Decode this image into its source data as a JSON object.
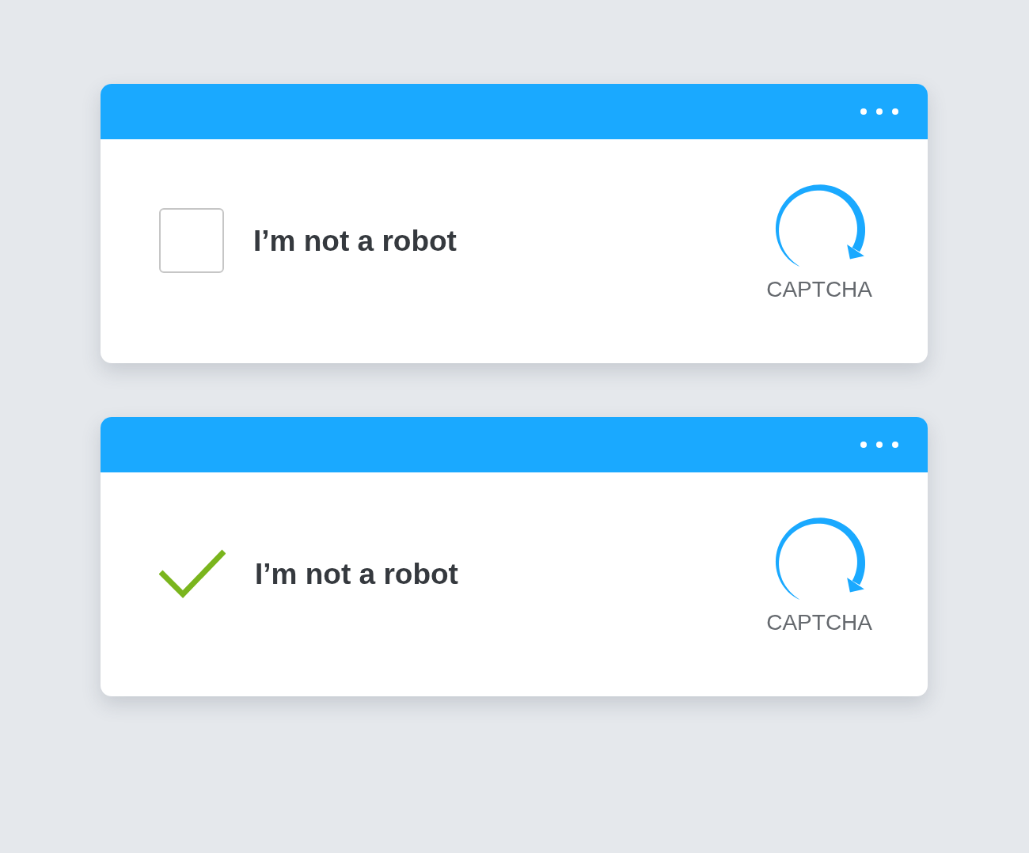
{
  "widgets": [
    {
      "checked": false,
      "label": "I’m not a robot",
      "logo_text": "CAPTCHA"
    },
    {
      "checked": true,
      "label": "I’m not a robot",
      "logo_text": "CAPTCHA"
    }
  ]
}
